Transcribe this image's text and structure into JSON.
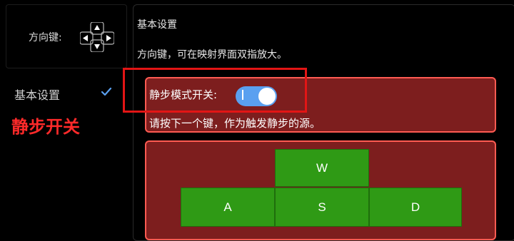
{
  "sidebar": {
    "dpad_label": "方向键:",
    "items": [
      {
        "label": "基本设置",
        "selected": true
      }
    ]
  },
  "annotation": {
    "label": "静步开关",
    "color": "#ff2a2a"
  },
  "panel": {
    "title": "基本设置",
    "description": "方向键，可在映射界面双指放大。",
    "step_mode": {
      "label": "静步模式开关:",
      "toggle_on": true,
      "hint": "请按下一个键，作为触发静步的源。"
    },
    "keys": [
      "W",
      "A",
      "S",
      "D"
    ]
  },
  "colors": {
    "card_bg": "#7d1e1e",
    "card_border": "#ff5b52",
    "toggle": "#5aa0f0",
    "key_green": "#2f9a15",
    "highlight": "#e21515"
  }
}
